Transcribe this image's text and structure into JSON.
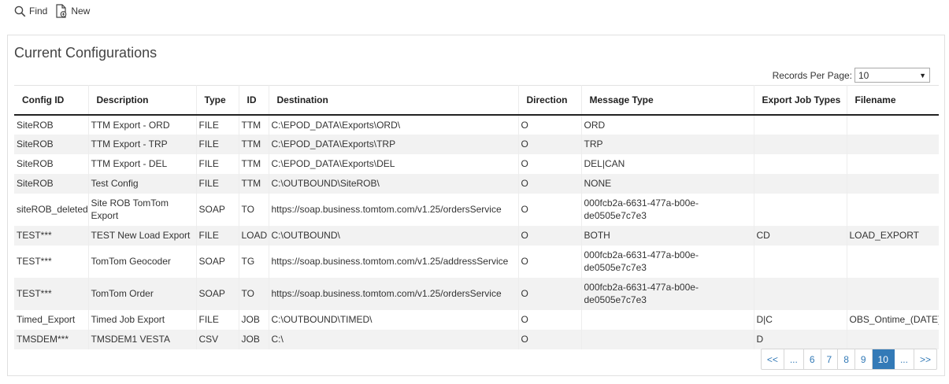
{
  "toolbar": {
    "find_label": "Find",
    "new_label": "New"
  },
  "panel": {
    "title": "Current Configurations",
    "records_per_page_label": "Records Per Page:",
    "records_per_page_value": "10"
  },
  "table": {
    "headers": [
      "Config ID",
      "Description",
      "Type",
      "ID",
      "Destination",
      "Direction",
      "Message Type",
      "Export Job Types",
      "Filename"
    ],
    "rows": [
      [
        "SiteROB",
        "TTM Export - ORD",
        "FILE",
        "TTM",
        "C:\\EPOD_DATA\\Exports\\ORD\\",
        "O",
        "ORD",
        "",
        ""
      ],
      [
        "SiteROB",
        "TTM Export - TRP",
        "FILE",
        "TTM",
        "C:\\EPOD_DATA\\Exports\\TRP",
        "O",
        "TRP",
        "",
        ""
      ],
      [
        "SiteROB",
        "TTM Export - DEL",
        "FILE",
        "TTM",
        "C:\\EPOD_DATA\\Exports\\DEL",
        "O",
        "DEL|CAN",
        "",
        ""
      ],
      [
        "SiteROB",
        "Test Config",
        "FILE",
        "TTM",
        "C:\\OUTBOUND\\SiteROB\\",
        "O",
        "NONE",
        "",
        ""
      ],
      [
        "siteROB_deleted",
        "Site ROB TomTom Export",
        "SOAP",
        "TO",
        "https://soap.business.tomtom.com/v1.25/ordersService",
        "O",
        "000fcb2a-6631-477a-b00e-de0505e7c7e3",
        "",
        ""
      ],
      [
        "TEST***",
        "TEST New Load Export",
        "FILE",
        "LOAD",
        "C:\\OUTBOUND\\",
        "O",
        "BOTH",
        "CD",
        "LOAD_EXPORT"
      ],
      [
        "TEST***",
        "TomTom Geocoder",
        "SOAP",
        "TG",
        "https://soap.business.tomtom.com/v1.25/addressService",
        "O",
        "000fcb2a-6631-477a-b00e-de0505e7c7e3",
        "",
        ""
      ],
      [
        "TEST***",
        "TomTom Order",
        "SOAP",
        "TO",
        "https://soap.business.tomtom.com/v1.25/ordersService",
        "O",
        "000fcb2a-6631-477a-b00e-de0505e7c7e3",
        "",
        ""
      ],
      [
        "Timed_Export",
        "Timed Job Export",
        "FILE",
        "JOB",
        "C:\\OUTBOUND\\TIMED\\",
        "O",
        "",
        "D|C",
        "OBS_Ontime_(DATE)"
      ],
      [
        "TMSDEM***",
        "TMSDEM1 VESTA",
        "CSV",
        "JOB",
        "C:\\",
        "O",
        "",
        "D",
        ""
      ]
    ]
  },
  "pagination": {
    "pages": [
      "<<",
      "...",
      "6",
      "7",
      "8",
      "9",
      "10",
      "...",
      ">>"
    ],
    "active": "10"
  },
  "colors": {
    "accent": "#337ab7",
    "stripe": "#f2f2f2"
  }
}
